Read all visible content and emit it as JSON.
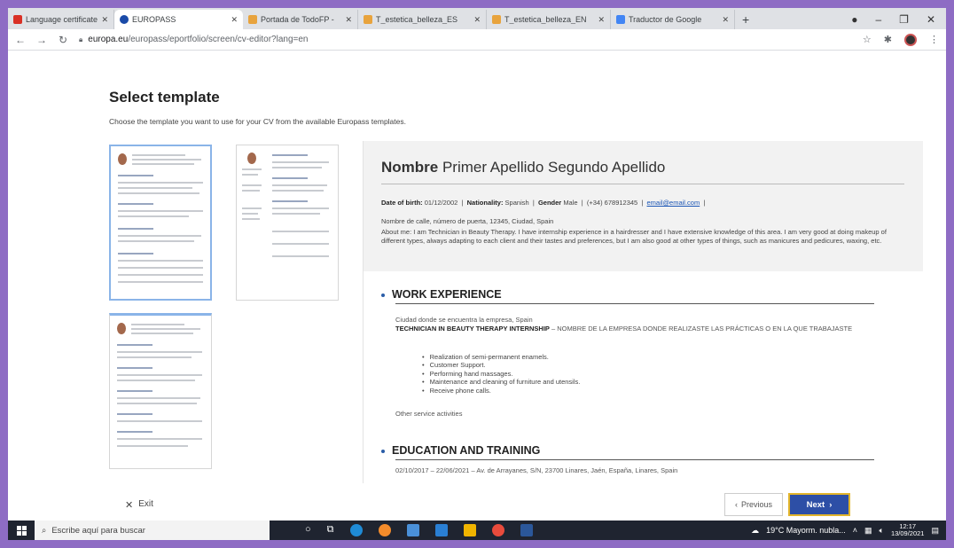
{
  "browser": {
    "tabs": [
      {
        "label": "Language certificates",
        "color": "#d93025"
      },
      {
        "label": "EUROPASS",
        "color": "#1a4aa8",
        "active": true
      },
      {
        "label": "Portada de TodoFP - ",
        "color": "#e8a33d"
      },
      {
        "label": "T_estetica_belleza_ES",
        "color": "#e8a33d"
      },
      {
        "label": "T_estetica_belleza_EN",
        "color": "#e8a33d"
      },
      {
        "label": "Traductor de Google",
        "color": "#4285f4"
      }
    ],
    "url_host": "europa.eu",
    "url_path": "/europass/eportfolio/screen/cv-editor?lang=en"
  },
  "page": {
    "title": "Select template",
    "subtitle": "Choose the template you want to use for your CV from the available Europass templates."
  },
  "cv": {
    "first_name": "Nombre",
    "last_names": "Primer Apellido Segundo Apellido",
    "dob_label": "Date of birth:",
    "dob": "01/12/2002",
    "nationality_label": "Nationality:",
    "nationality": "Spanish",
    "gender_label": "Gender",
    "gender": "Male",
    "phone": "(+34) 678912345",
    "email": "email@email.com",
    "address": "Nombre de calle, número de puerta, 12345, Ciudad, Spain",
    "about": "About me: I am Technician in Beauty Therapy. I have internship experience in a hairdresser and I have extensive knowledge of this area. I am very good at doing makeup of different types, always adapting to each client and their tastes and preferences, but I am also good at other types of things, such as manicures and pedicures, waxing, etc.",
    "work_title": "WORK EXPERIENCE",
    "job_location": "Ciudad donde se encuentra la empresa, Spain",
    "job_title": "TECHNICIAN IN BEAUTY THERAPY INTERNSHIP",
    "job_company": " – NOMBRE DE LA EMPRESA DONDE REALIZASTE LAS PRÁCTICAS O EN LA QUE TRABAJASTE",
    "duties": [
      "Realization of semi-permanent enamels.",
      "Customer Support.",
      "Performing hand massages.",
      "Maintenance and cleaning of furniture and utensils.",
      "Receive phone calls."
    ],
    "other": "Other service activities",
    "edu_title": "EDUCATION AND TRAINING",
    "edu_line": "02/10/2017 – 22/06/2021 – Av. de Arrayanes, S/N, 23700 Linares, Jaén, España, Linares, Spain"
  },
  "footer": {
    "exit": "Exit",
    "previous": "Previous",
    "next": "Next"
  },
  "taskbar": {
    "search_placeholder": "Escribe aquí para buscar",
    "weather": "19°C  Mayorm. nubla...",
    "time": "12:17",
    "date": "13/09/2021"
  }
}
